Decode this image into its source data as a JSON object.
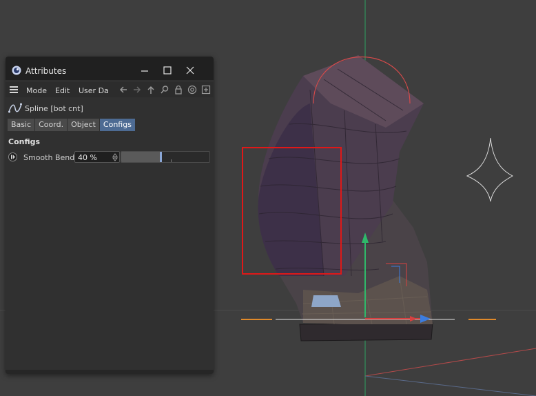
{
  "window": {
    "title": "Attributes",
    "icons": {
      "logo": "cinema4d-logo-icon",
      "minimize": "minimize-icon",
      "maximize": "maximize-icon",
      "close": "close-icon"
    }
  },
  "menubar": {
    "items": [
      "Mode",
      "Edit",
      "User Da"
    ],
    "nav_icons": [
      "hamburger-menu-icon",
      "arrow-left-icon",
      "arrow-right-icon",
      "arrow-up-icon",
      "search-icon",
      "lock-icon",
      "target-icon",
      "new-panel-icon"
    ]
  },
  "object": {
    "name": "Spline [bot cnt]",
    "icon": "spline-icon"
  },
  "tabs": [
    {
      "label": "Basic",
      "active": false
    },
    {
      "label": "Coord.",
      "active": false
    },
    {
      "label": "Object",
      "active": false
    },
    {
      "label": "Configs",
      "active": true
    }
  ],
  "section": {
    "title": "Configs"
  },
  "parameter": {
    "label": "Smooth Bend",
    "value": "40 %",
    "slider_fraction": 0.4
  },
  "colors": {
    "accent_tab": "#4d6b93",
    "highlight_box": "#e01818",
    "arrow": "#e02020",
    "axis_y": "#2fb86a",
    "axis_x": "#d94040",
    "axis_z": "#3c7de0",
    "mesh": "#4a3d4a"
  }
}
